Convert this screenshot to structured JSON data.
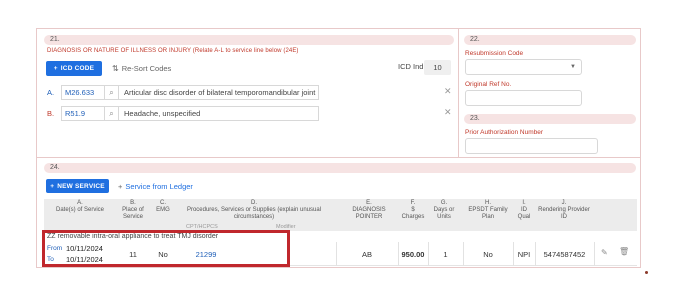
{
  "section21": {
    "number": "21.",
    "title": "DIAGNOSIS OR NATURE OF ILLNESS OR INJURY (Relate A-L to service line below (24E)"
  },
  "toolbar": {
    "icd_code_label": "ICD CODE",
    "re_sort_label": "Re-Sort Codes",
    "icd_ind_label": "ICD Ind.",
    "icd_ind_value": "10"
  },
  "diagnoses": [
    {
      "letter": "A.",
      "code": "M26.633",
      "description": "Articular disc disorder of bilateral temporomandibular joint"
    },
    {
      "letter": "B.",
      "code": "R51.9",
      "description": "Headache, unspecified"
    }
  ],
  "section22": {
    "number": "22.",
    "resubmission_label": "Resubmission Code",
    "original_ref_label": "Original Ref No."
  },
  "section23": {
    "number": "23.",
    "prior_auth_label": "Prior Authorization Number"
  },
  "section24": {
    "number": "24.",
    "new_service_label": "NEW SERVICE",
    "service_from_ledger_label": "Service from Ledger",
    "headers": {
      "a": [
        "A.",
        "Date(s) of Service"
      ],
      "b": [
        "B.",
        "Place of",
        "Service"
      ],
      "c": [
        "C.",
        "EMG"
      ],
      "d": [
        "D.",
        "Procedures, Services or Supplies (explain unusual",
        "circumstances)"
      ],
      "d_sub": [
        "CPT/HCPCS",
        "Modifier"
      ],
      "e": [
        "E.",
        "DIAGNOSIS",
        "POINTER"
      ],
      "f": [
        "F.",
        "$",
        "Charges"
      ],
      "g": [
        "G.",
        "Days or",
        "Units"
      ],
      "h": [
        "H.",
        "EPSDT Family",
        "Plan"
      ],
      "i": [
        "I.",
        "ID",
        "Qual"
      ],
      "j": [
        "J.",
        "Rendering Provider",
        "ID"
      ]
    },
    "row": {
      "note": "ZZ removable intra-oral appliance to treat TMJ disorder",
      "from_label": "From",
      "from_date": "10/11/2024",
      "to_label": "To",
      "to_date": "10/11/2024",
      "place_of_service": "11",
      "emg": "No",
      "cpt": "21299",
      "diagnosis_pointer": "AB",
      "charges": "950.00",
      "units": "1",
      "epsdt": "No",
      "id_qual": "NPI",
      "rendering_provider_id": "5474587452"
    }
  },
  "colors": {
    "accent": "#1f6fe0",
    "label_red": "#c0392b",
    "highlight_red": "#c0282d"
  }
}
